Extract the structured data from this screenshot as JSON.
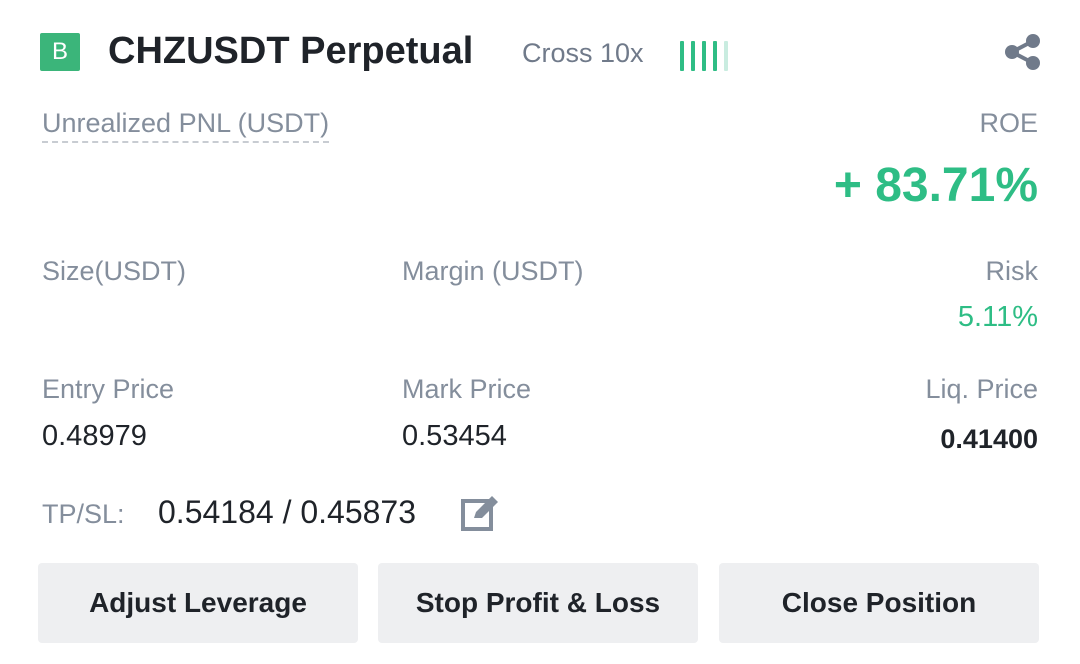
{
  "header": {
    "side_badge": "B",
    "symbol": "CHZUSDT Perpetual",
    "margin_mode": "Cross 10x",
    "colors": {
      "brand_green": "#3bb57a",
      "profit_green": "#2ebd85"
    },
    "icons": {
      "share": "share-icon",
      "signal": "signal-bars-icon"
    }
  },
  "pnl": {
    "label": "Unrealized PNL (USDT)",
    "roe_label": "ROE",
    "roe_value": "+ 83.71%"
  },
  "stats_row1": {
    "size_label": "Size(USDT)",
    "margin_label": "Margin (USDT)",
    "risk_label": "Risk",
    "risk_value": "5.11%"
  },
  "stats_row2": {
    "entry_label": "Entry Price",
    "entry_value": "0.48979",
    "mark_label": "Mark Price",
    "mark_value": "0.53454",
    "liq_label": "Liq. Price",
    "liq_value": "0.41400"
  },
  "tpsl": {
    "label": "TP/SL:",
    "values": "0.54184 / 0.45873",
    "edit_icon": "edit-icon"
  },
  "actions": {
    "adjust_leverage": "Adjust Leverage",
    "stop_profit_loss": "Stop Profit & Loss",
    "close_position": "Close Position"
  }
}
